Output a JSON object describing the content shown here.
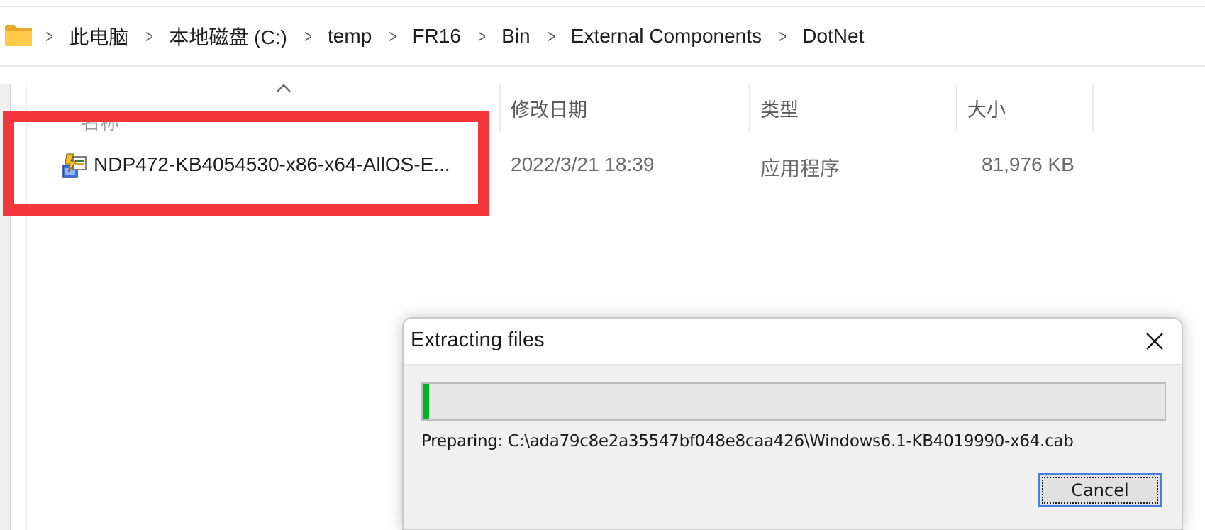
{
  "breadcrumb": {
    "icon": "folder-icon",
    "items": [
      "此电脑",
      "本地磁盘 (C:)",
      "temp",
      "FR16",
      "Bin",
      "External Components",
      "DotNet"
    ]
  },
  "columns": {
    "name": "名称",
    "date": "修改日期",
    "type": "类型",
    "size": "大小"
  },
  "file": {
    "icon": "installer-icon",
    "name": "NDP472-KB4054530-x86-x64-AllOS-E...",
    "date": "2022/3/21 18:39",
    "type": "应用程序",
    "size": "81,976 KB"
  },
  "colors": {
    "highlight": "#f4363b",
    "progress": "#06b025",
    "focus_border": "#4a7ee0"
  },
  "dialog": {
    "title": "Extracting files",
    "progress_fraction": 0.009,
    "status": "Preparing: C:\\ada79c8e2a35547bf048e8caa426\\Windows6.1-KB4019990-x64.cab",
    "cancel_label": "Cancel"
  }
}
